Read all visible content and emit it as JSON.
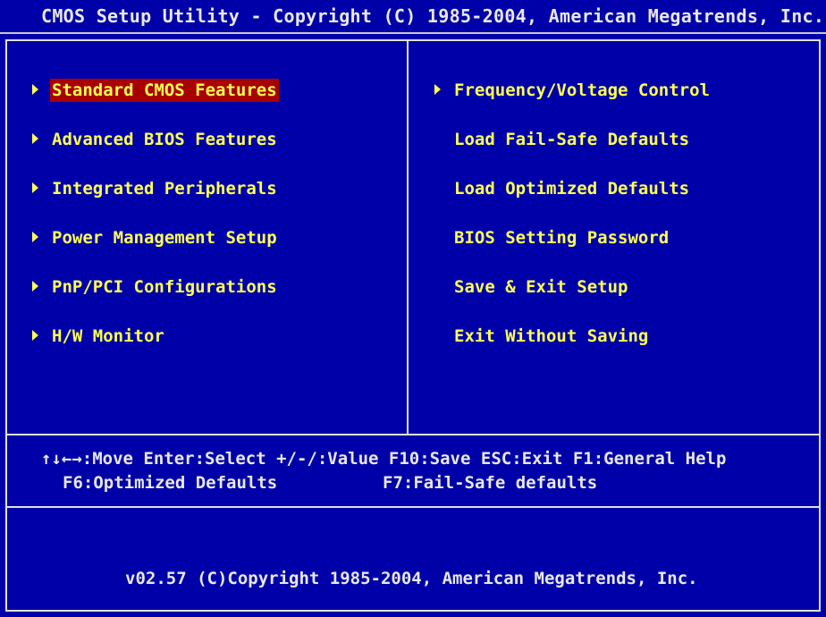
{
  "title": "CMOS Setup Utility - Copyright (C) 1985-2004, American Megatrends, Inc.",
  "left_menu": [
    {
      "label": "Standard CMOS Features",
      "submenu": true,
      "selected": true
    },
    {
      "label": "Advanced BIOS Features",
      "submenu": true,
      "selected": false
    },
    {
      "label": "Integrated Peripherals",
      "submenu": true,
      "selected": false
    },
    {
      "label": "Power Management Setup",
      "submenu": true,
      "selected": false
    },
    {
      "label": "PnP/PCI Configurations",
      "submenu": true,
      "selected": false
    },
    {
      "label": "H/W Monitor",
      "submenu": true,
      "selected": false
    }
  ],
  "right_menu": [
    {
      "label": "Frequency/Voltage Control",
      "submenu": true
    },
    {
      "label": "Load Fail-Safe Defaults",
      "submenu": false
    },
    {
      "label": "Load Optimized Defaults",
      "submenu": false
    },
    {
      "label": "BIOS Setting Password",
      "submenu": false
    },
    {
      "label": "Save & Exit Setup",
      "submenu": false
    },
    {
      "label": "Exit Without Saving",
      "submenu": false
    }
  ],
  "help": {
    "line1": "↑↓←→:Move  Enter:Select  +/-/:Value  F10:Save  ESC:Exit  F1:General Help",
    "line2_left": "F6:Optimized Defaults",
    "line2_right": "F7:Fail-Safe defaults"
  },
  "footer": "v02.57 (C)Copyright 1985-2004, American Megatrends, Inc.",
  "colors": {
    "background": "#0000a8",
    "menu_text": "#ffff54",
    "highlight": "#a80000",
    "border": "#e0e0e0",
    "text": "#e8e8e8"
  }
}
